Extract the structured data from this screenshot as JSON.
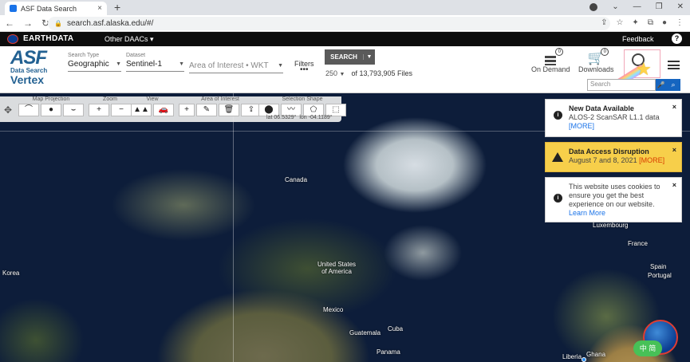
{
  "browser": {
    "tab_title": "ASF Data Search",
    "new_tab": "+",
    "url": "search.asf.alaska.edu/#/"
  },
  "earthdata": {
    "logo": "EARTHDATA",
    "other_daacs": "Other DAACs ▾",
    "feedback": "Feedback",
    "help": "?"
  },
  "logo": {
    "asf": "ASF",
    "data_search": "Data Search",
    "vertex": "Vertex"
  },
  "search_type": {
    "label": "Search Type",
    "value": "Geographic"
  },
  "dataset": {
    "label": "Dataset",
    "value": "Sentinel-1"
  },
  "aoi": {
    "placeholder": "Area of Interest • WKT"
  },
  "filters": {
    "label": "Filters",
    "dots": "•••"
  },
  "search_button": {
    "label": "SEARCH"
  },
  "results": {
    "max": "250",
    "count": "of 13,793,905 Files"
  },
  "header_icons": {
    "on_demand": {
      "label": "On Demand",
      "badge": "0"
    },
    "downloads": {
      "label": "Downloads",
      "badge": "0"
    }
  },
  "find": {
    "placeholder": "Search"
  },
  "toolbar": {
    "map_projection": "Map Projection",
    "zoom": "Zoom",
    "view": "View",
    "area_of_interest": "Area of Interest",
    "selection_shape": "Selection Shape",
    "zoom_in": "+",
    "zoom_out": "−",
    "aoi_add": "+"
  },
  "coords": {
    "lat": "lat 06.5329°",
    "lon": "lon -04.1189°"
  },
  "map_labels": {
    "canada": "Canada",
    "united_states": "United States\nof America",
    "mexico": "Mexico",
    "cuba": "Cuba",
    "guatemala": "Guatemala",
    "panama": "Panama",
    "korea": "Korea",
    "luxembourg": "Luxembourg",
    "france": "France",
    "spain": "Spain",
    "portugal": "Portugal",
    "liberia": "Liberia",
    "ghana": "Ghana"
  },
  "notifications": [
    {
      "title": "New Data Available",
      "body": "ALOS-2 ScanSAR L1.1 data",
      "link": "[MORE]",
      "close": "×"
    },
    {
      "title": "Data Access Disruption",
      "body": "August 7 and 8, 2021",
      "link": "[MORE]",
      "close": "×"
    },
    {
      "body": "This website uses cookies to ensure you get the best experience on our website.",
      "link": "Learn More",
      "close": "×"
    }
  ],
  "ime": {
    "label": "中 简"
  },
  "colors": {
    "brand": "#236192",
    "toolbar_search": "#5a5a5a",
    "warning": "#f7cf4a",
    "link": "#1a73e8"
  }
}
